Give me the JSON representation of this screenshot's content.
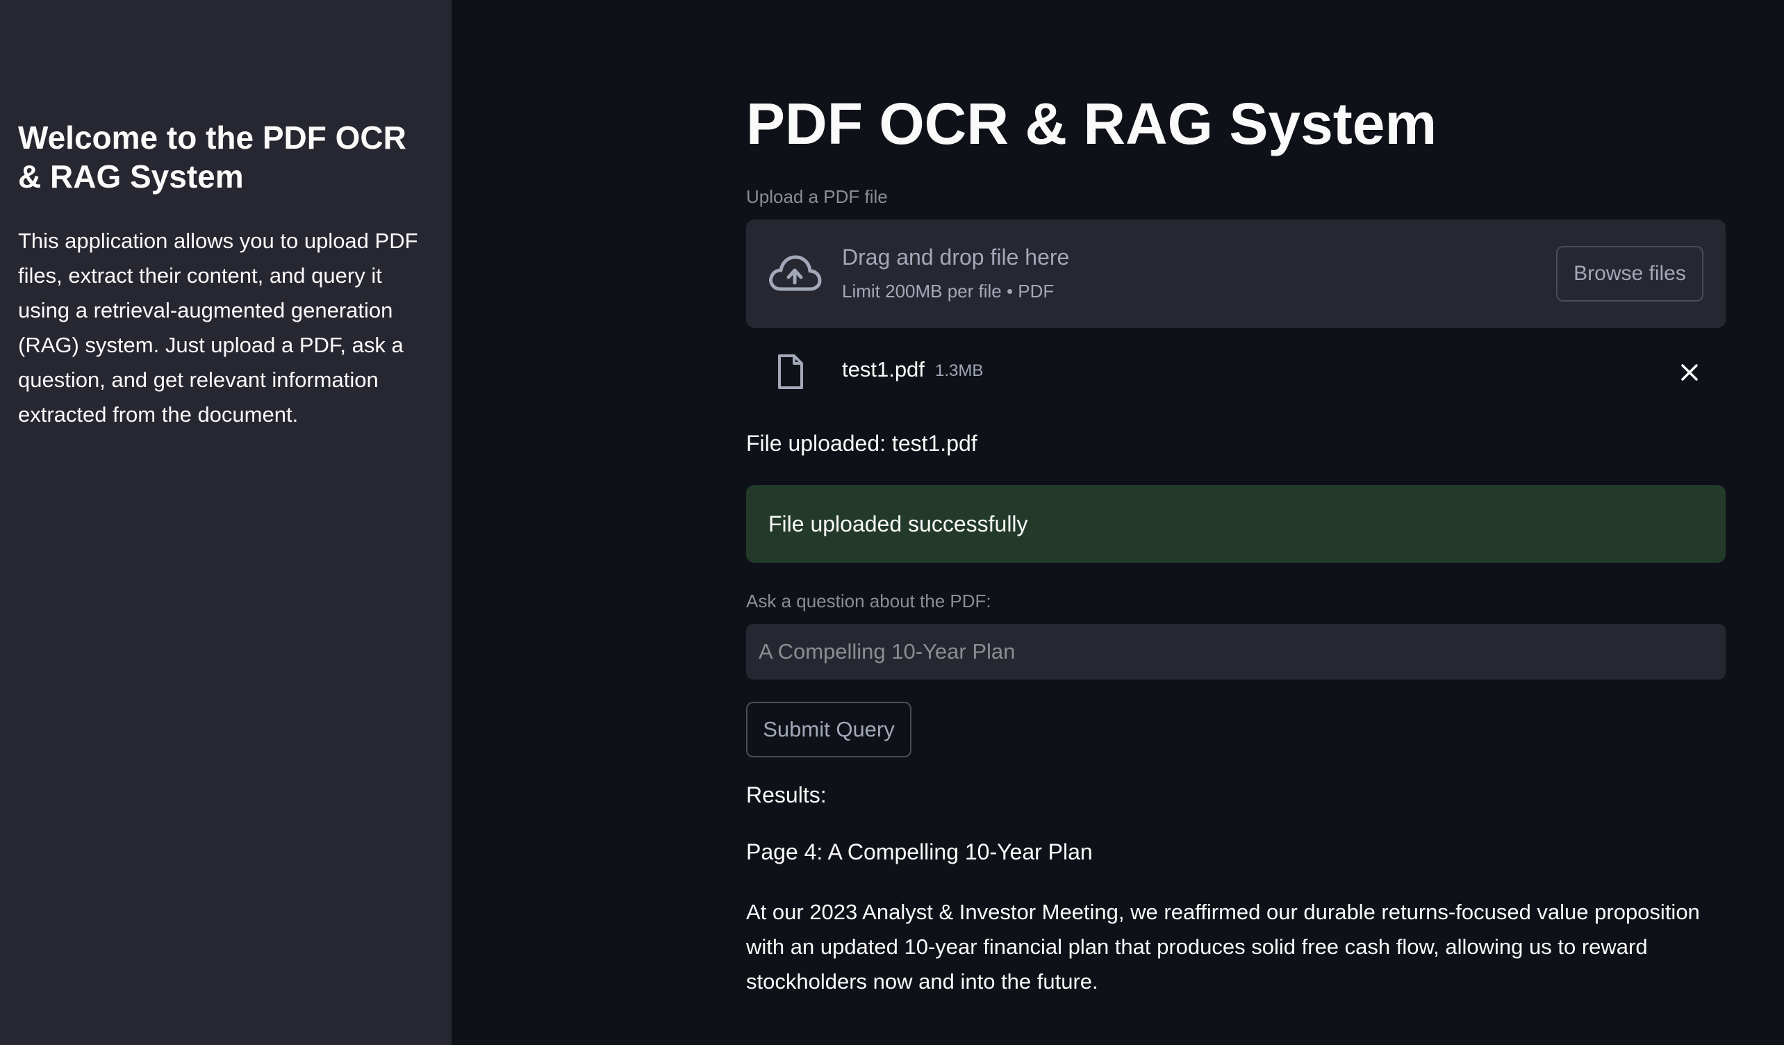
{
  "sidebar": {
    "title": "Welcome to the PDF OCR & RAG System",
    "description": "This application allows you to upload PDF files, extract their content, and query it using a retrieval-augmented generation (RAG) system. Just upload a PDF, ask a question, and get relevant information extracted from the document."
  },
  "main": {
    "title": "PDF OCR & RAG System",
    "uploader": {
      "label": "Upload a PDF file",
      "drag_text": "Drag and drop file here",
      "limit_text": "Limit 200MB per file • PDF",
      "browse_label": "Browse files",
      "icon": "cloud-upload-icon"
    },
    "uploaded_file": {
      "name": "test1.pdf",
      "size": "1.3MB",
      "icon": "file-icon"
    },
    "file_uploaded_text": "File uploaded: test1.pdf",
    "success_message": "File uploaded successfully",
    "question": {
      "label": "Ask a question about the PDF:",
      "value": "A Compelling 10-Year Plan"
    },
    "submit_label": "Submit Query",
    "results": {
      "heading": "Results:",
      "page_line": "Page 4: A Compelling 10-Year Plan",
      "body": "At our 2023 Analyst & Investor Meeting, we reaffirmed our durable returns-focused value proposition with an updated 10-year financial plan that produces solid free cash flow, allowing us to reward stockholders now and into the future."
    }
  },
  "colors": {
    "background": "#0e1117",
    "sidebar": "#262730",
    "success_bg": "#233a2b",
    "muted_text": "#a3a8b8"
  }
}
